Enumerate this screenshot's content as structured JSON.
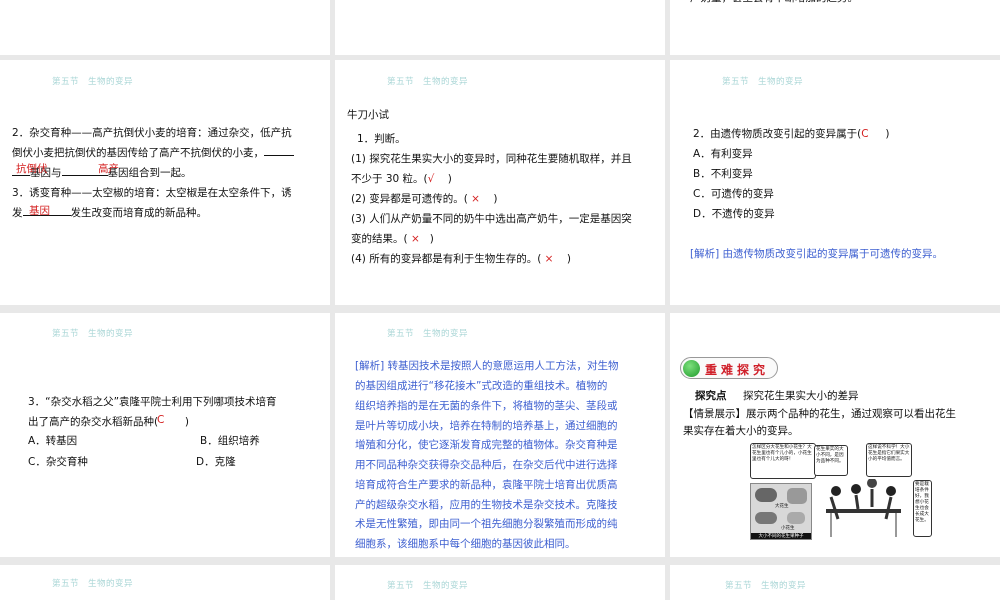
{
  "section_header": "第五节　生物的变异",
  "slides": {
    "top_partial_right": {
      "text": "产奶量，甚至会有不断增加的趋势。"
    },
    "s1": {
      "lines": [
        "2．杂交育种——高产抗倒伏小麦的培育：通过杂交，低产抗",
        "倒伏小麦把抗倒伏的基因传给了高产不抗倒伏的小麦，",
        "基因与",
        "基因组合到一起。",
        "3．诱变育种——太空椒的培育：太空椒是在太空条件下，诱",
        "发",
        "发生改变而培育成的新品种。"
      ],
      "answers": [
        "抗倒伏",
        "高产",
        "基因"
      ]
    },
    "s2": {
      "title": "牛刀小试",
      "lines": [
        "1．判断。",
        "(1) 探究花生果实大小的变异时，同种花生要随机取样，并且",
        "不少于 30 粒。(",
        "(2) 变异都是可遗传的。(",
        "(3) 人们从产奶量不同的奶牛中选出高产奶牛，一定是基因突",
        "变的结果。(",
        "(4) 所有的变异都是有利于生物生存的。("
      ],
      "close": ")",
      "answers": [
        "√",
        "×",
        "×",
        "×"
      ]
    },
    "s3": {
      "question": "2．由遗传物质改变引起的变异属于(",
      "close": ")",
      "answer": "C",
      "options": [
        "A．有利变异",
        "B．不利变异",
        "C．可遗传的变异",
        "D．不遗传的变异"
      ],
      "analysis": "[解析] 由遗传物质改变引起的变异属于可遗传的变异。"
    },
    "s4": {
      "lines": [
        "3．“杂交水稻之父”袁隆平院士利用下列哪项技术培育",
        "出了高产的杂交水稻新品种("
      ],
      "close": ")",
      "answer": "C",
      "options": [
        "A．转基因",
        "B．组织培养",
        "C．杂交育种",
        "D．克隆"
      ]
    },
    "s5": {
      "analysis_lines": [
        "[解析] 转基因技术是按照人的意愿运用人工方法，对生物",
        "的基因组成进行“移花接木”式改造的重组技术。植物的",
        "组织培养指的是在无菌的条件下，将植物的茎尖、茎段或",
        "是叶片等切成小块，培养在特制的培养基上，通过细胞的",
        "增殖和分化，使它逐渐发育成完整的植物体。杂交育种是",
        "用不同品种杂交获得杂交品种后，在杂交后代中进行选择",
        "培育成符合生产要求的新品种，袁隆平院士培育出优质高",
        "产的超级杂交水稻，应用的生物技术是杂交技术。克隆技",
        "术是无性繁殖，即由同一个祖先细胞分裂繁殖而形成的纯",
        "细胞系，该细胞系中每个细胞的基因彼此相同。"
      ]
    },
    "s6": {
      "badge": "重难探究",
      "point_label": "探究点",
      "point_title": "探究花生果实大小的差异",
      "scene_lines": [
        "【情景展示】展示两个品种的花生，通过观察可以看出花生",
        "果实存在着大小的变异。"
      ],
      "bubbles": [
        "怎样区分大花生和小花生？大花生里也有个儿小的，小花生里也有个儿大的呀！",
        "花生果实的大小不同，是因为品种不同。",
        "这样说不科学！大小花生是指它们果实大小的平均值而言。",
        "要是栽培条件好，我想小花生也会长成大花生。"
      ],
      "labels": [
        "大花生",
        "小花生",
        "大小不同的花生果种子"
      ]
    }
  },
  "colors": {
    "header": "#a9d6d6",
    "answer": "#d42020",
    "analysis": "#3d5fd0",
    "gap": "#e8e8e8"
  }
}
